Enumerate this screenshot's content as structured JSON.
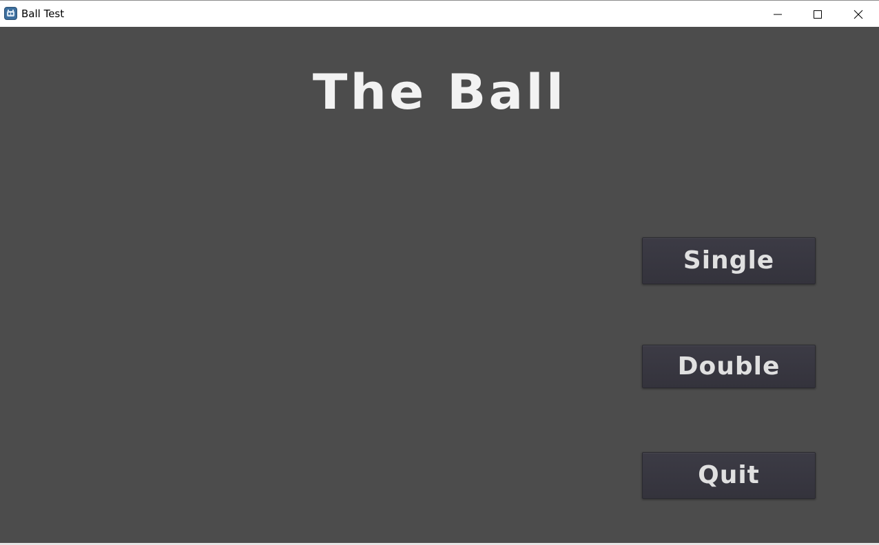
{
  "window": {
    "title": "Ball Test",
    "app_icon": "godot-engine-icon",
    "controls": [
      "minimize-icon",
      "maximize-icon",
      "close-icon"
    ]
  },
  "game": {
    "title": "The Ball",
    "background_color": "#4c4c4c",
    "menu": {
      "single_label": "Single",
      "double_label": "Double",
      "quit_label": "Quit"
    }
  }
}
